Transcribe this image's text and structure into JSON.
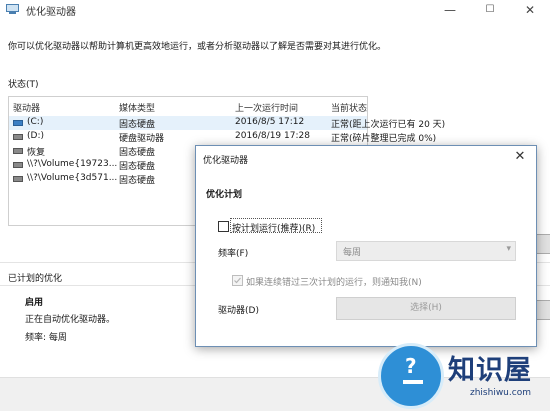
{
  "window": {
    "title": "优化驱动器",
    "controls": {
      "minimize": "—",
      "maximize": "☐",
      "close": "✕"
    }
  },
  "main": {
    "description": "你可以优化驱动器以帮助计算机更高效地运行，或者分析驱动器以了解是否需要对其进行优化。",
    "status_label": "状态(T)",
    "columns": [
      "驱动器",
      "媒体类型",
      "上一次运行时间",
      "当前状态"
    ],
    "rows": [
      {
        "drive": "(C:)",
        "media": "固态硬盘",
        "last_run": "2016/8/5 17:12",
        "status": "正常(距上次运行已有 20 天)"
      },
      {
        "drive": "(D:)",
        "media": "硬盘驱动器",
        "last_run": "2016/8/19 17:28",
        "status": "正常(碎片整理已完成 0%)"
      },
      {
        "drive": "恢复",
        "media": "固态硬盘",
        "last_run": "",
        "status": ""
      },
      {
        "drive": "\\\\?\\Volume{19723...",
        "media": "固态硬盘",
        "last_run": "",
        "status": ""
      },
      {
        "drive": "\\\\?\\Volume{3d571...",
        "media": "固态硬盘",
        "last_run": "",
        "status": ""
      }
    ],
    "scheduled_label": "已计划的优化",
    "enabled": "启用",
    "auto_text": "正在自动优化驱动器。",
    "frequency_text": "频率: 每周"
  },
  "dialog": {
    "title": "优化驱动器",
    "close": "✕",
    "heading": "优化计划",
    "run_on_schedule": "按计划运行(推荐)(R)",
    "frequency_label": "频率(F)",
    "frequency_value": "每周",
    "notify": "如果连续错过三次计划的运行，则通知我(N)",
    "drives_label": "驱动器(D)",
    "choose_button": "选择(H)"
  },
  "watermark": {
    "brand": "知识屋",
    "url": "zhishiwu.com",
    "symbol": "?"
  },
  "colors": {
    "selected_row": "#e5f1fb",
    "watermark_blue": "#2e8fd6",
    "dialog_border": "#6d8fb4"
  }
}
